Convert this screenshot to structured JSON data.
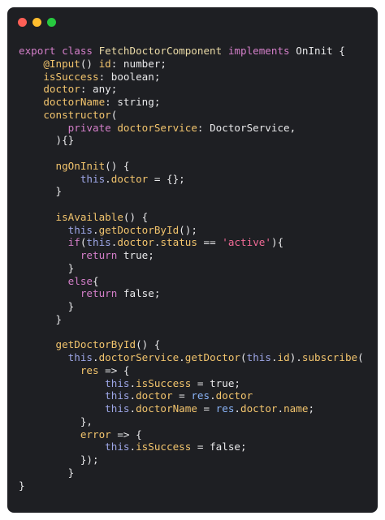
{
  "window": {
    "controls": [
      {
        "name": "close",
        "color": "#ff5f56"
      },
      {
        "name": "minimize",
        "color": "#ffbd2e"
      },
      {
        "name": "maximize",
        "color": "#27c93f"
      }
    ]
  },
  "code": {
    "lines": [
      [
        {
          "t": "export class ",
          "c": "kw"
        },
        {
          "t": "FetchDoctorComponent",
          "c": "cls"
        },
        {
          "t": " implements ",
          "c": "kw"
        },
        {
          "t": "OnInit {",
          "c": "pl"
        }
      ],
      [
        {
          "t": "    @Input",
          "c": "prop"
        },
        {
          "t": "() ",
          "c": "pl"
        },
        {
          "t": "id",
          "c": "prop"
        },
        {
          "t": ": number;",
          "c": "pl"
        }
      ],
      [
        {
          "t": "    isSuccess",
          "c": "prop"
        },
        {
          "t": ": boolean;",
          "c": "pl"
        }
      ],
      [
        {
          "t": "    doctor",
          "c": "prop"
        },
        {
          "t": ": any;",
          "c": "pl"
        }
      ],
      [
        {
          "t": "    doctorName",
          "c": "prop"
        },
        {
          "t": ": string;",
          "c": "pl"
        }
      ],
      [
        {
          "t": "    constructor",
          "c": "prop"
        },
        {
          "t": "(",
          "c": "pl"
        }
      ],
      [
        {
          "t": "        private ",
          "c": "kw"
        },
        {
          "t": "doctorService",
          "c": "prop"
        },
        {
          "t": ": DoctorService,",
          "c": "pl"
        }
      ],
      [
        {
          "t": "      ){}",
          "c": "pl"
        }
      ],
      [
        {
          "t": "",
          "c": "pl"
        }
      ],
      [
        {
          "t": "      ngOnInit",
          "c": "prop"
        },
        {
          "t": "() {",
          "c": "pl"
        }
      ],
      [
        {
          "t": "          this",
          "c": "this"
        },
        {
          "t": ".",
          "c": "pl"
        },
        {
          "t": "doctor",
          "c": "prop"
        },
        {
          "t": " = {};",
          "c": "pl"
        }
      ],
      [
        {
          "t": "      }",
          "c": "pl"
        }
      ],
      [
        {
          "t": "",
          "c": "pl"
        }
      ],
      [
        {
          "t": "      isAvailable",
          "c": "prop"
        },
        {
          "t": "() {",
          "c": "pl"
        }
      ],
      [
        {
          "t": "        this",
          "c": "this"
        },
        {
          "t": ".",
          "c": "pl"
        },
        {
          "t": "getDoctorById",
          "c": "prop"
        },
        {
          "t": "();",
          "c": "pl"
        }
      ],
      [
        {
          "t": "        if",
          "c": "kw"
        },
        {
          "t": "(",
          "c": "pl"
        },
        {
          "t": "this",
          "c": "this"
        },
        {
          "t": ".",
          "c": "pl"
        },
        {
          "t": "doctor",
          "c": "prop"
        },
        {
          "t": ".",
          "c": "pl"
        },
        {
          "t": "status",
          "c": "prop"
        },
        {
          "t": " == ",
          "c": "pl"
        },
        {
          "t": "'active'",
          "c": "str"
        },
        {
          "t": "){",
          "c": "pl"
        }
      ],
      [
        {
          "t": "          return ",
          "c": "kw"
        },
        {
          "t": "true;",
          "c": "pl"
        }
      ],
      [
        {
          "t": "        }",
          "c": "pl"
        }
      ],
      [
        {
          "t": "        else",
          "c": "kw"
        },
        {
          "t": "{",
          "c": "pl"
        }
      ],
      [
        {
          "t": "          return ",
          "c": "kw"
        },
        {
          "t": "false;",
          "c": "pl"
        }
      ],
      [
        {
          "t": "        }",
          "c": "pl"
        }
      ],
      [
        {
          "t": "      }",
          "c": "pl"
        }
      ],
      [
        {
          "t": "",
          "c": "pl"
        }
      ],
      [
        {
          "t": "      getDoctorById",
          "c": "prop"
        },
        {
          "t": "() {",
          "c": "pl"
        }
      ],
      [
        {
          "t": "        this",
          "c": "this"
        },
        {
          "t": ".",
          "c": "pl"
        },
        {
          "t": "doctorService",
          "c": "prop"
        },
        {
          "t": ".",
          "c": "pl"
        },
        {
          "t": "getDoctor",
          "c": "prop"
        },
        {
          "t": "(",
          "c": "pl"
        },
        {
          "t": "this",
          "c": "this"
        },
        {
          "t": ".",
          "c": "pl"
        },
        {
          "t": "id",
          "c": "prop"
        },
        {
          "t": ").",
          "c": "pl"
        },
        {
          "t": "subscribe",
          "c": "prop"
        },
        {
          "t": "(",
          "c": "pl"
        }
      ],
      [
        {
          "t": "          res",
          "c": "prop"
        },
        {
          "t": " => {",
          "c": "pl"
        }
      ],
      [
        {
          "t": "              this",
          "c": "this"
        },
        {
          "t": ".",
          "c": "pl"
        },
        {
          "t": "isSuccess",
          "c": "prop"
        },
        {
          "t": " = true;",
          "c": "pl"
        }
      ],
      [
        {
          "t": "              this",
          "c": "this"
        },
        {
          "t": ".",
          "c": "pl"
        },
        {
          "t": "doctor",
          "c": "prop"
        },
        {
          "t": " = ",
          "c": "pl"
        },
        {
          "t": "res",
          "c": "res"
        },
        {
          "t": ".",
          "c": "pl"
        },
        {
          "t": "doctor",
          "c": "prop"
        }
      ],
      [
        {
          "t": "              this",
          "c": "this"
        },
        {
          "t": ".",
          "c": "pl"
        },
        {
          "t": "doctorName",
          "c": "prop"
        },
        {
          "t": " = ",
          "c": "pl"
        },
        {
          "t": "res",
          "c": "res"
        },
        {
          "t": ".",
          "c": "pl"
        },
        {
          "t": "doctor",
          "c": "prop"
        },
        {
          "t": ".",
          "c": "pl"
        },
        {
          "t": "name",
          "c": "prop"
        },
        {
          "t": ";",
          "c": "pl"
        }
      ],
      [
        {
          "t": "          },",
          "c": "pl"
        }
      ],
      [
        {
          "t": "          error",
          "c": "prop"
        },
        {
          "t": " => {",
          "c": "pl"
        }
      ],
      [
        {
          "t": "              this",
          "c": "this"
        },
        {
          "t": ".",
          "c": "pl"
        },
        {
          "t": "isSuccess",
          "c": "prop"
        },
        {
          "t": " = false;",
          "c": "pl"
        }
      ],
      [
        {
          "t": "          });",
          "c": "pl"
        }
      ],
      [
        {
          "t": "        }",
          "c": "pl"
        }
      ],
      [
        {
          "t": "}",
          "c": "pl"
        }
      ]
    ]
  }
}
